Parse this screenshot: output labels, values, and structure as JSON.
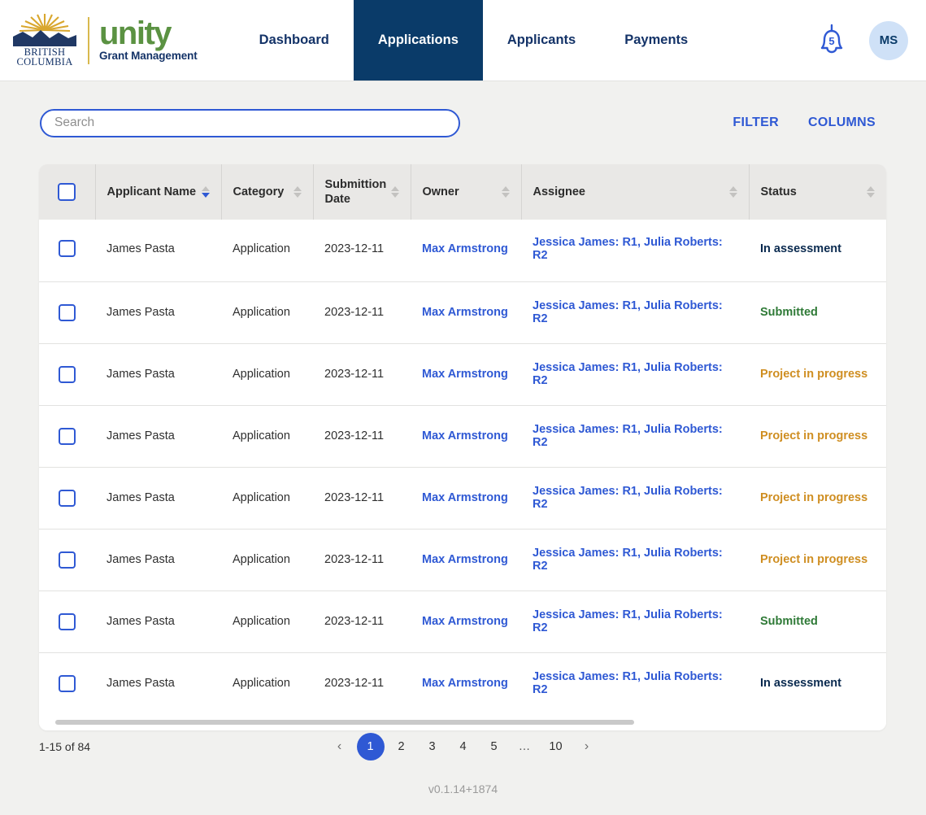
{
  "header": {
    "logo": {
      "bc_line1": "BRITISH",
      "bc_line2": "COLUMBIA",
      "product": "unity",
      "tagline": "Grant Management"
    },
    "nav": [
      {
        "label": "Dashboard",
        "active": false
      },
      {
        "label": "Applications",
        "active": true
      },
      {
        "label": "Applicants",
        "active": false
      },
      {
        "label": "Payments",
        "active": false
      }
    ],
    "notification_count": "5",
    "avatar_initials": "MS"
  },
  "toolbar": {
    "search_placeholder": "Search",
    "search_value": "",
    "filter_label": "FILTER",
    "columns_label": "COLUMNS"
  },
  "table": {
    "columns": [
      {
        "label": "Applicant Name",
        "sorted": "desc"
      },
      {
        "label": "Category",
        "sorted": "none"
      },
      {
        "label": "Submittion Date",
        "sorted": "none"
      },
      {
        "label": "Owner",
        "sorted": "none"
      },
      {
        "label": "Assignee",
        "sorted": "none"
      },
      {
        "label": "Status",
        "sorted": "none"
      }
    ],
    "rows": [
      {
        "applicant": "James Pasta",
        "category": "Application",
        "date": "2023-12-11",
        "owner": "Max Armstrong",
        "assignee": "Jessica James: R1, Julia Roberts: R2",
        "status": "In assessment",
        "status_kind": "assess"
      },
      {
        "applicant": "James Pasta",
        "category": "Application",
        "date": "2023-12-11",
        "owner": "Max Armstrong",
        "assignee": "Jessica James: R1, Julia Roberts: R2",
        "status": "Submitted",
        "status_kind": "submitted"
      },
      {
        "applicant": "James Pasta",
        "category": "Application",
        "date": "2023-12-11",
        "owner": "Max Armstrong",
        "assignee": "Jessica James: R1, Julia Roberts: R2",
        "status": "Project in progress",
        "status_kind": "progress"
      },
      {
        "applicant": "James Pasta",
        "category": "Application",
        "date": "2023-12-11",
        "owner": "Max Armstrong",
        "assignee": "Jessica James: R1, Julia Roberts: R2",
        "status": "Project in progress",
        "status_kind": "progress"
      },
      {
        "applicant": "James Pasta",
        "category": "Application",
        "date": "2023-12-11",
        "owner": "Max Armstrong",
        "assignee": "Jessica James: R1, Julia Roberts: R2",
        "status": "Project in progress",
        "status_kind": "progress"
      },
      {
        "applicant": "James Pasta",
        "category": "Application",
        "date": "2023-12-11",
        "owner": "Max Armstrong",
        "assignee": "Jessica James: R1, Julia Roberts: R2",
        "status": "Project in progress",
        "status_kind": "progress"
      },
      {
        "applicant": "James Pasta",
        "category": "Application",
        "date": "2023-12-11",
        "owner": "Max Armstrong",
        "assignee": "Jessica James: R1, Julia Roberts: R2",
        "status": "Submitted",
        "status_kind": "submitted"
      },
      {
        "applicant": "James Pasta",
        "category": "Application",
        "date": "2023-12-11",
        "owner": "Max Armstrong",
        "assignee": "Jessica James: R1, Julia Roberts: R2",
        "status": "In assessment",
        "status_kind": "assess"
      }
    ]
  },
  "footer": {
    "range": "1-15 of 84",
    "pages": [
      "1",
      "2",
      "3",
      "4",
      "5",
      "…",
      "10"
    ],
    "active_page": "1",
    "prev_icon": "‹",
    "next_icon": "›",
    "version": "v0.1.14+1874"
  },
  "colors": {
    "brand_navy": "#0a3b69",
    "brand_green": "#5b9242",
    "accent_blue": "#2f59d4",
    "status_submitted": "#2f7a37",
    "status_progress": "#cf8e21",
    "status_assessment": "#0a2a4f",
    "page_bg": "#f1f1ef",
    "header_bg": "#e9e8e6"
  }
}
